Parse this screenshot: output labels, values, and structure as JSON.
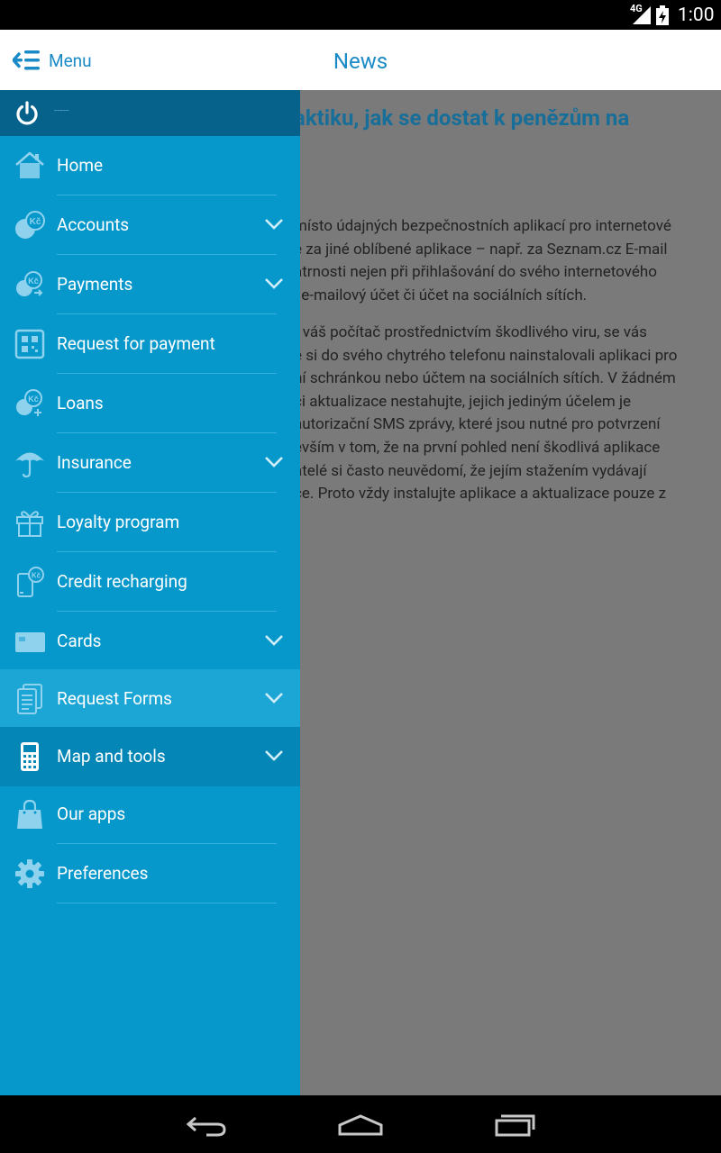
{
  "status_bar": {
    "network": "4G",
    "time": "1:00"
  },
  "action_bar": {
    "menu_label": "Menu",
    "title": "News"
  },
  "article": {
    "title": "aktiku, jak se dostat k penězům na",
    "paragraph1": [
      "místo údajných bezpečnostních aplikací pro internetové",
      "é za jiné oblíbené aplikace – např. za Seznam.cz E-mail",
      "atrnosti nejen při přihlašování do svého internetového",
      "j e-mailový účet či účet na sociálních sítích."
    ],
    "paragraph2": [
      "t váš počítač prostřednictvím škodlivého viru, se vás",
      "e si do svého chytrého telefonu nainstalovali aplikaci pro",
      "ní schránkou nebo účtem na sociálních sítích. V žádném",
      "či aktualizace nestahujte, jejich jediným účelem je",
      "autorizační SMS zprávy, které jsou nutné pro potvrzení",
      "evším v tom, že na první pohled není škodlivá aplikace",
      "atelé si často neuvědomí, že jejím stažením vydávají",
      "ce. Proto vždy instalujte aplikace a aktualizace pouze z"
    ]
  },
  "drawer": {
    "user_name": "-----",
    "items": [
      {
        "label": "Home",
        "icon": "home-icon",
        "expandable": false
      },
      {
        "label": "Accounts",
        "icon": "coins-kc-icon",
        "expandable": true
      },
      {
        "label": "Payments",
        "icon": "payment-kc-icon",
        "expandable": true
      },
      {
        "label": "Request for payment",
        "icon": "qr-code-icon",
        "expandable": false
      },
      {
        "label": "Loans",
        "icon": "loan-kc-icon",
        "expandable": false
      },
      {
        "label": "Insurance",
        "icon": "umbrella-icon",
        "expandable": true
      },
      {
        "label": "Loyalty program",
        "icon": "gift-icon",
        "expandable": false
      },
      {
        "label": "Credit recharging",
        "icon": "phone-kc-icon",
        "expandable": false
      },
      {
        "label": "Cards",
        "icon": "card-icon",
        "expandable": true
      },
      {
        "label": "Request Forms",
        "icon": "documents-icon",
        "expandable": true
      },
      {
        "label": "Map and tools",
        "icon": "calculator-icon",
        "expandable": true
      },
      {
        "label": "Our apps",
        "icon": "shopping-bag-icon",
        "expandable": false
      },
      {
        "label": "Preferences",
        "icon": "gear-icon",
        "expandable": false
      }
    ]
  },
  "colors": {
    "accent": "#1a8bc6",
    "drawer_bg": "#0798cb",
    "drawer_header": "#06628a",
    "icon_light": "#8fd2ee"
  }
}
